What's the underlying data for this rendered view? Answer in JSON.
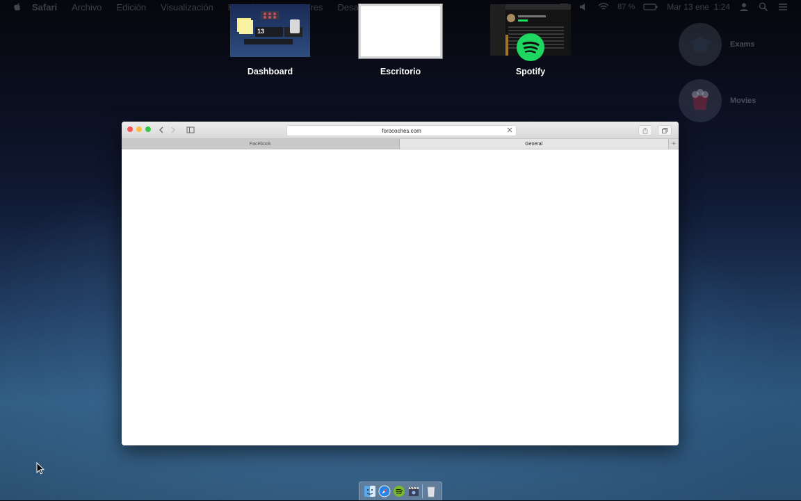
{
  "menubar": {
    "app": "Safari",
    "items": [
      "Archivo",
      "Edición",
      "Visualización",
      "Historial",
      "Marcadores",
      "Desarr"
    ],
    "status": {
      "battery": "87 %",
      "clock": "Mar 13 ene  1:24"
    }
  },
  "mission_control": {
    "spaces": [
      {
        "label": "Dashboard"
      },
      {
        "label": "Escritorio"
      },
      {
        "label": "Spotify"
      }
    ],
    "dashboard_date": "13"
  },
  "desktop_icons": [
    {
      "label": "Exams"
    },
    {
      "label": "Movies"
    }
  ],
  "safari": {
    "url": "forocoches.com",
    "tabs": [
      {
        "label": "Facebook"
      },
      {
        "label": "General"
      }
    ],
    "add_tab": "+"
  },
  "dock": {
    "apps": [
      "finder",
      "safari",
      "spotify",
      "imovie",
      "trash"
    ]
  },
  "colors": {
    "close": "#fc5753",
    "minimize": "#fdbc40",
    "zoom": "#33c748",
    "spotify": "#1ed760"
  }
}
